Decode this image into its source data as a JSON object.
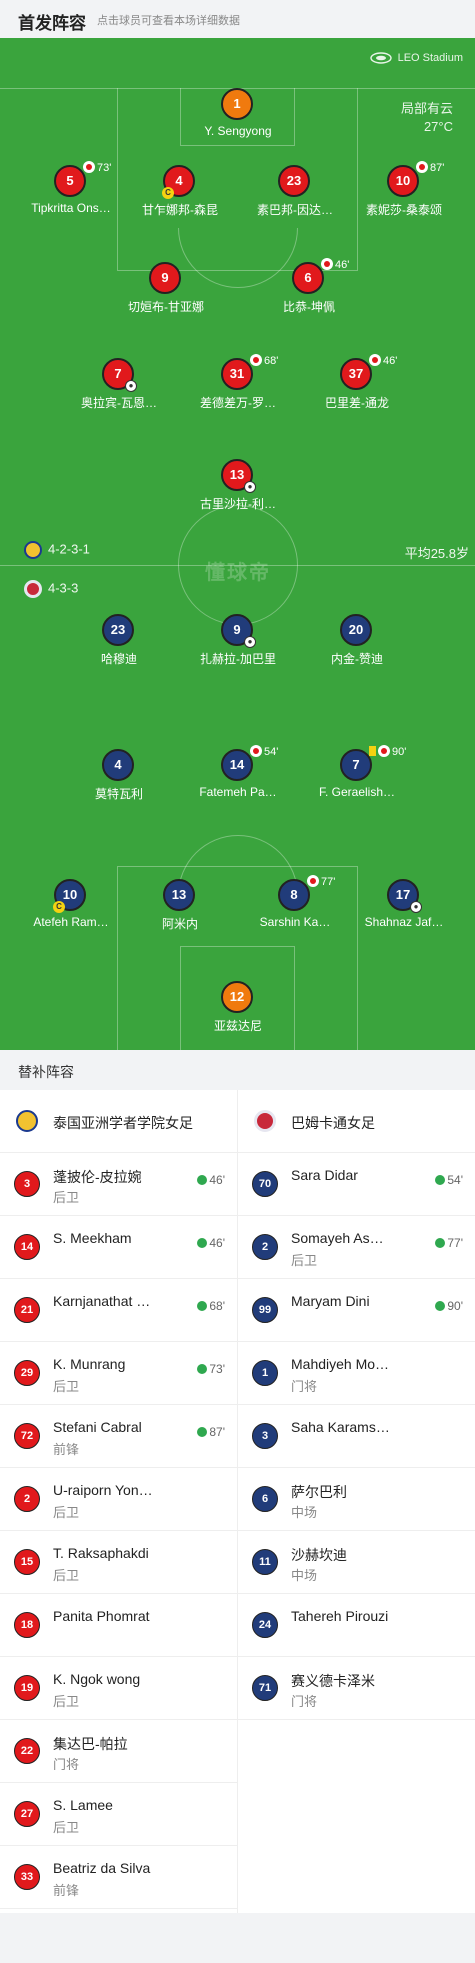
{
  "header": {
    "title": "首发阵容",
    "subtitle": "点击球员可查看本场详细数据"
  },
  "field": {
    "stadium": "LEO Stadium",
    "weather": "局部有云",
    "temperature": "27°C",
    "watermark": "懂球帝",
    "home_formation": "4-2-3-1",
    "away_formation": "4-3-3",
    "average_age": "平均25.8岁",
    "colors": {
      "pitch": "#3aa43d",
      "home": "#e1191c",
      "away": "#213c7a",
      "goalkeeper": "#f07a0e"
    }
  },
  "home_players": [
    {
      "num": "1",
      "name": "Y. Sengyong"
    },
    {
      "num": "5",
      "name": "Tipkritta Ons…",
      "sub": "73'"
    },
    {
      "num": "4",
      "name": "甘乍娜邦-森昆",
      "captain": "C"
    },
    {
      "num": "23",
      "name": "素巴邦-因达…"
    },
    {
      "num": "10",
      "name": "素妮莎-桑泰颂",
      "sub": "87'"
    },
    {
      "num": "9",
      "name": "切姮布-甘亚娜"
    },
    {
      "num": "6",
      "name": "比恭-坤佩",
      "sub": "46'"
    },
    {
      "num": "7",
      "name": "奥拉宾-瓦恩…"
    },
    {
      "num": "31",
      "name": "差德差万-罗…",
      "sub": "68'"
    },
    {
      "num": "37",
      "name": "巴里差-通龙",
      "sub": "46'"
    },
    {
      "num": "13",
      "name": "古里沙拉-利…"
    }
  ],
  "away_players": [
    {
      "num": "23",
      "name": "哈穆迪"
    },
    {
      "num": "9",
      "name": "扎赫拉-加巴里"
    },
    {
      "num": "20",
      "name": "内金-赞迪"
    },
    {
      "num": "4",
      "name": "莫特瓦利"
    },
    {
      "num": "14",
      "name": "Fatemeh Pa…",
      "sub": "54'"
    },
    {
      "num": "7",
      "name": "F. Geraelish…",
      "sub": "90'"
    },
    {
      "num": "10",
      "name": "Atefeh Ram…",
      "captain": "C"
    },
    {
      "num": "13",
      "name": "阿米内"
    },
    {
      "num": "8",
      "name": "Sarshin Ka…",
      "sub": "77'"
    },
    {
      "num": "17",
      "name": "Shahnaz Jaf…"
    },
    {
      "num": "12",
      "name": "亚兹达尼"
    }
  ],
  "subs_section": {
    "title": "替补阵容"
  },
  "home_team": {
    "name": "泰国亚洲学者学院女足"
  },
  "away_team": {
    "name": "巴姆卡通女足"
  },
  "home_subs": [
    {
      "num": "3",
      "name": "蓬披伦-皮拉婉",
      "pos": "后卫",
      "min": "46'"
    },
    {
      "num": "14",
      "name": "S. Meekham",
      "pos": "",
      "min": "46'"
    },
    {
      "num": "21",
      "name": "Karnjanathat …",
      "pos": "",
      "min": "68'"
    },
    {
      "num": "29",
      "name": "K. Munrang",
      "pos": "后卫",
      "min": "73'"
    },
    {
      "num": "72",
      "name": "Stefani Cabral",
      "pos": "前锋",
      "min": "87'"
    },
    {
      "num": "2",
      "name": "U-raiporn Yon…",
      "pos": "后卫",
      "min": ""
    },
    {
      "num": "15",
      "name": "T. Raksaphakdi",
      "pos": "后卫",
      "min": ""
    },
    {
      "num": "18",
      "name": "Panita Phomrat",
      "pos": "",
      "min": ""
    },
    {
      "num": "19",
      "name": "K. Ngok wong",
      "pos": "后卫",
      "min": ""
    },
    {
      "num": "22",
      "name": "集达巴-帕拉",
      "pos": "门将",
      "min": ""
    },
    {
      "num": "27",
      "name": "S. Lamee",
      "pos": "后卫",
      "min": ""
    },
    {
      "num": "33",
      "name": "Beatriz da Silva",
      "pos": "前锋",
      "min": ""
    }
  ],
  "away_subs": [
    {
      "num": "70",
      "name": "Sara Didar",
      "pos": "",
      "min": "54'"
    },
    {
      "num": "2",
      "name": "Somayeh As…",
      "pos": "后卫",
      "min": "77'"
    },
    {
      "num": "99",
      "name": "Maryam Dini",
      "pos": "",
      "min": "90'"
    },
    {
      "num": "1",
      "name": "Mahdiyeh Mo…",
      "pos": "门将",
      "min": ""
    },
    {
      "num": "3",
      "name": "Saha Karams…",
      "pos": "",
      "min": ""
    },
    {
      "num": "6",
      "name": "萨尔巴利",
      "pos": "中场",
      "min": ""
    },
    {
      "num": "11",
      "name": "沙赫坎迪",
      "pos": "中场",
      "min": ""
    },
    {
      "num": "24",
      "name": "Tahereh Pirouzi",
      "pos": "",
      "min": ""
    },
    {
      "num": "71",
      "name": "赛义德卡泽米",
      "pos": "门将",
      "min": ""
    }
  ]
}
